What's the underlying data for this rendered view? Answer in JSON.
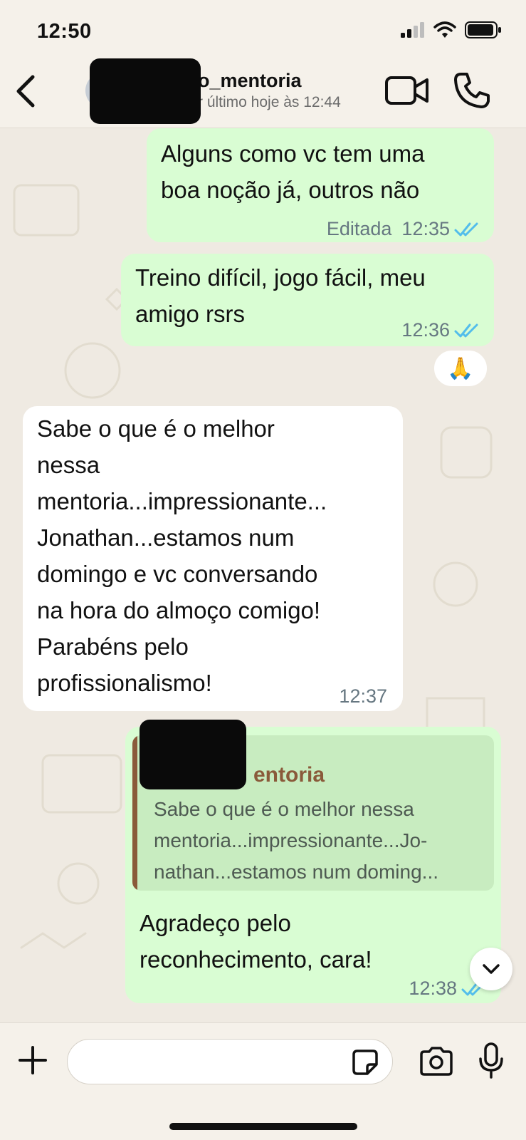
{
  "status_bar": {
    "time": "12:50"
  },
  "header": {
    "contact_name_visible": "o_mentoria",
    "last_seen_visible": "r último hoje às 12:44"
  },
  "messages": [
    {
      "direction": "out",
      "text": "Alguns como vc tem uma\nboa noção já, outros não",
      "edited_label": "Editada",
      "time": "12:35",
      "read": true
    },
    {
      "direction": "out",
      "text": "Treino difícil, jogo fácil, meu\namigo rsrs",
      "time": "12:36",
      "read": true,
      "reaction": "🙏"
    },
    {
      "direction": "in",
      "text": "Sabe o que é o melhor\nnessa\nmentoria...impressionante...\nJonathan...estamos num\ndomingo e vc conversando\nna hora do almoço comigo!\nParabéns pelo\nprofissionalismo!",
      "time": "12:37"
    },
    {
      "direction": "out",
      "quote": {
        "author_visible": "entoria",
        "text": "Sabe o que é o melhor nessa\nmentoria...impressionante...Jo-\nnathan...estamos num doming..."
      },
      "text": "Agradeço pelo\nreconhecimento, cara!",
      "time": "12:38",
      "read": true
    }
  ],
  "input": {
    "placeholder": "",
    "value": ""
  },
  "colors": {
    "chat_background": "#efeae2",
    "outgoing_bubble": "#d9fdd3",
    "incoming_bubble": "#ffffff",
    "read_ticks": "#53bdeb",
    "quote_accent": "#8a5a3a"
  },
  "icons": [
    "back-chevron-icon",
    "video-call-icon",
    "phone-icon",
    "double-check-icon",
    "chevron-down-icon",
    "plus-icon",
    "sticker-icon",
    "camera-icon",
    "microphone-icon"
  ]
}
